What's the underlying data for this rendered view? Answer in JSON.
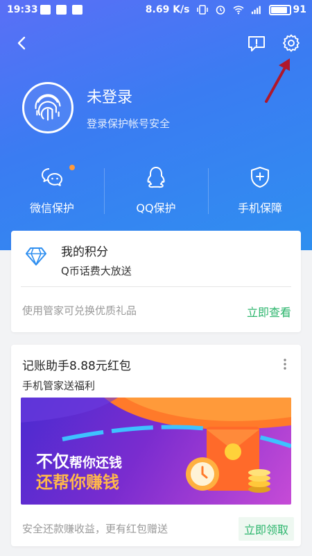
{
  "status_bar": {
    "time": "19:33",
    "net_speed": "8.69 K/s",
    "battery": "91"
  },
  "header": {
    "user_name": "未登录",
    "user_subtitle": "登录保护帐号安全",
    "icons": {
      "back": "back-arrow-icon",
      "message": "feedback-icon",
      "settings": "gear-icon"
    },
    "protection_items": [
      {
        "label": "微信保护",
        "icon": "wechat-icon",
        "badge": true
      },
      {
        "label": "QQ保护",
        "icon": "qq-icon",
        "badge": false
      },
      {
        "label": "手机保障",
        "icon": "shield-plus-icon",
        "badge": false
      }
    ]
  },
  "points_card": {
    "title": "我的积分",
    "subtitle": "Q币话费大放送",
    "footer_text": "使用管家可兑换优质礼品",
    "action": "立即查看",
    "icon": "diamond-icon"
  },
  "promo_card": {
    "title": "记账助手8.88元红包",
    "subtitle": "手机管家送福利",
    "banner_line1_big": "不仅",
    "banner_line1_small": "帮你还钱",
    "banner_line2": "还帮你赚钱",
    "footer_text": "安全还款赚收益，更有红包赠送",
    "action": "立即领取"
  },
  "colors": {
    "header_gradient_start": "#5a6ff6",
    "header_gradient_end": "#2f8ff0",
    "action_green": "#2bb56c",
    "annotation_arrow": "#b0172b"
  }
}
